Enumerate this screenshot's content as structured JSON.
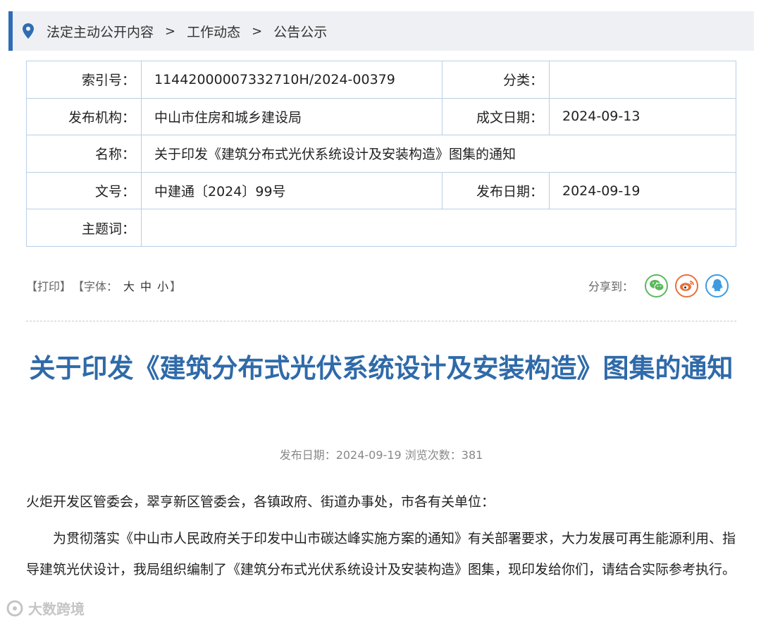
{
  "breadcrumb": {
    "items": [
      "法定主动公开内容",
      "工作动态",
      "公告公示"
    ],
    "separator": ">"
  },
  "meta": {
    "index_label": "索引号：",
    "index_value": "11442000007332710H/2024-00379",
    "category_label": "分类：",
    "category_value": "",
    "publisher_label": "发布机构：",
    "publisher_value": "中山市住房和城乡建设局",
    "created_label": "成文日期：",
    "created_value": "2024-09-13",
    "name_label": "名称：",
    "name_value": "关于印发《建筑分布式光伏系统设计及安装构造》图集的通知",
    "docno_label": "文号：",
    "docno_value": "中建通〔2024〕99号",
    "pubdate_label": "发布日期：",
    "pubdate_value": "2024-09-19",
    "keyword_label": "主题词：",
    "keyword_value": ""
  },
  "toolbar": {
    "print": "【打印】",
    "font_prefix": "【字体：",
    "font_large": "大",
    "font_medium": "中",
    "font_small": "小",
    "font_suffix": "】",
    "share_label": "分享到：",
    "share_icons": [
      "wechat-icon",
      "weibo-icon",
      "qq-icon"
    ]
  },
  "article": {
    "title": "关于印发《建筑分布式光伏系统设计及安装构造》图集的通知",
    "pubinfo": "发布日期：2024-09-19  浏览次数：381",
    "addressee": "火炬开发区管委会，翠亨新区管委会，各镇政府、街道办事处，市各有关单位：",
    "paragraph1": "为贯彻落实《中山市人民政府关于印发中山市碳达峰实施方案的通知》有关部署要求，大力发展可再生能源利用、指导建筑光伏设计，我局组织编制了《建筑分布式光伏系统设计及安装构造》图集，现印发给你们，请结合实际参考执行。"
  },
  "watermark": "大数跨境",
  "colors": {
    "accent": "#2f6db3",
    "title": "#2f6aa9",
    "wechat": "#5cb85c",
    "weibo": "#e8703a",
    "qq": "#3d9be0"
  }
}
